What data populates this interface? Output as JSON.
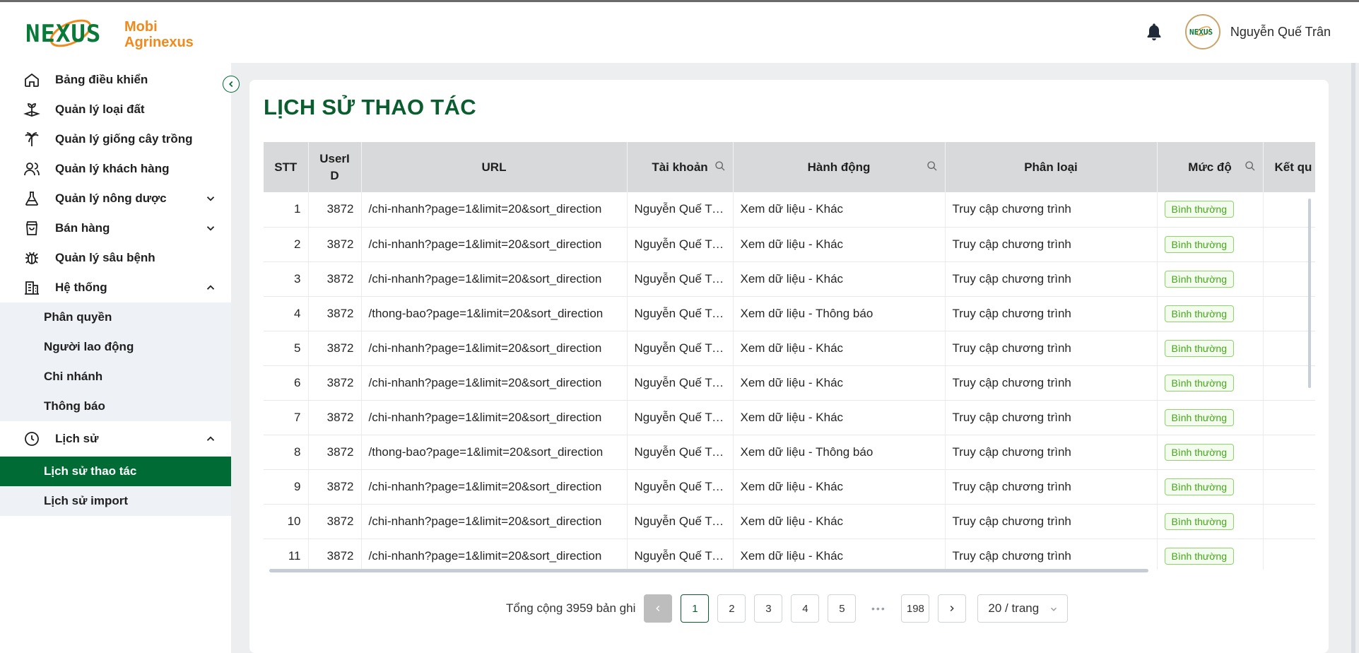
{
  "app": {
    "brand_line1": "Mobi",
    "brand_line2": "Agrinexus",
    "user_name": "Nguyễn Quế Trân",
    "accent_color": "#006b35",
    "brand_orange": "#f08a1c"
  },
  "sidebar": {
    "items": [
      {
        "label": "Bảng điều khiển",
        "icon": "home-icon"
      },
      {
        "label": "Quản lý loại đất",
        "icon": "soil-icon"
      },
      {
        "label": "Quản lý giống cây trồng",
        "icon": "palm-tree-icon"
      },
      {
        "label": "Quản lý khách hàng",
        "icon": "users-icon"
      },
      {
        "label": "Quản lý nông dược",
        "icon": "flask-icon",
        "expandable": true
      },
      {
        "label": "Bán hàng",
        "icon": "shopping-bag-icon",
        "expandable": true
      },
      {
        "label": "Quản lý sâu bệnh",
        "icon": "bug-icon"
      },
      {
        "label": "Hệ thống",
        "icon": "building-icon",
        "expanded": true
      },
      {
        "label": "Lịch sử",
        "icon": "clock-icon",
        "expanded": true
      }
    ],
    "system_sub": [
      "Phân quyền",
      "Người lao động",
      "Chi nhánh",
      "Thông báo"
    ],
    "history_sub": [
      "Lịch sử thao tác",
      "Lịch sử import"
    ],
    "active": "Lịch sử thao tác"
  },
  "page": {
    "title": "LỊCH SỬ THAO TÁC"
  },
  "table": {
    "columns": [
      "STT",
      "UserI D",
      "URL",
      "Tài khoản",
      "Hành động",
      "Phân loại",
      "Mức độ",
      "Kết qu"
    ],
    "rows": [
      {
        "stt": "1",
        "uid": "3872",
        "url": "/chi-nhanh?page=1&limit=20&sort_direction",
        "account": "Nguyễn Quế Trân",
        "action": "Xem dữ liệu - Khác",
        "type": "Truy cập chương trình",
        "level": "Bình thường"
      },
      {
        "stt": "2",
        "uid": "3872",
        "url": "/chi-nhanh?page=1&limit=20&sort_direction",
        "account": "Nguyễn Quế Trân",
        "action": "Xem dữ liệu - Khác",
        "type": "Truy cập chương trình",
        "level": "Bình thường"
      },
      {
        "stt": "3",
        "uid": "3872",
        "url": "/chi-nhanh?page=1&limit=20&sort_direction",
        "account": "Nguyễn Quế Trân",
        "action": "Xem dữ liệu - Khác",
        "type": "Truy cập chương trình",
        "level": "Bình thường"
      },
      {
        "stt": "4",
        "uid": "3872",
        "url": "/thong-bao?page=1&limit=20&sort_direction",
        "account": "Nguyễn Quế Trân",
        "action": "Xem dữ liệu - Thông báo",
        "type": "Truy cập chương trình",
        "level": "Bình thường"
      },
      {
        "stt": "5",
        "uid": "3872",
        "url": "/chi-nhanh?page=1&limit=20&sort_direction",
        "account": "Nguyễn Quế Trân",
        "action": "Xem dữ liệu - Khác",
        "type": "Truy cập chương trình",
        "level": "Bình thường"
      },
      {
        "stt": "6",
        "uid": "3872",
        "url": "/chi-nhanh?page=1&limit=20&sort_direction",
        "account": "Nguyễn Quế Trân",
        "action": "Xem dữ liệu - Khác",
        "type": "Truy cập chương trình",
        "level": "Bình thường"
      },
      {
        "stt": "7",
        "uid": "3872",
        "url": "/chi-nhanh?page=1&limit=20&sort_direction",
        "account": "Nguyễn Quế Trân",
        "action": "Xem dữ liệu - Khác",
        "type": "Truy cập chương trình",
        "level": "Bình thường"
      },
      {
        "stt": "8",
        "uid": "3872",
        "url": "/thong-bao?page=1&limit=20&sort_direction",
        "account": "Nguyễn Quế Trân",
        "action": "Xem dữ liệu - Thông báo",
        "type": "Truy cập chương trình",
        "level": "Bình thường"
      },
      {
        "stt": "9",
        "uid": "3872",
        "url": "/chi-nhanh?page=1&limit=20&sort_direction",
        "account": "Nguyễn Quế Trân",
        "action": "Xem dữ liệu - Khác",
        "type": "Truy cập chương trình",
        "level": "Bình thường"
      },
      {
        "stt": "10",
        "uid": "3872",
        "url": "/chi-nhanh?page=1&limit=20&sort_direction",
        "account": "Nguyễn Quế Trân",
        "action": "Xem dữ liệu - Khác",
        "type": "Truy cập chương trình",
        "level": "Bình thường"
      },
      {
        "stt": "11",
        "uid": "3872",
        "url": "/chi-nhanh?page=1&limit=20&sort_direction",
        "account": "Nguyễn Quế Trân",
        "action": "Xem dữ liệu - Khác",
        "type": "Truy cập chương trình",
        "level": "Bình thường"
      }
    ]
  },
  "pagination": {
    "total_text": "Tổng cộng 3959 bản ghi",
    "pages": [
      "1",
      "2",
      "3",
      "4",
      "5"
    ],
    "last_page": "198",
    "current": "1",
    "page_size": "20 / trang",
    "ellipsis": "•••"
  }
}
